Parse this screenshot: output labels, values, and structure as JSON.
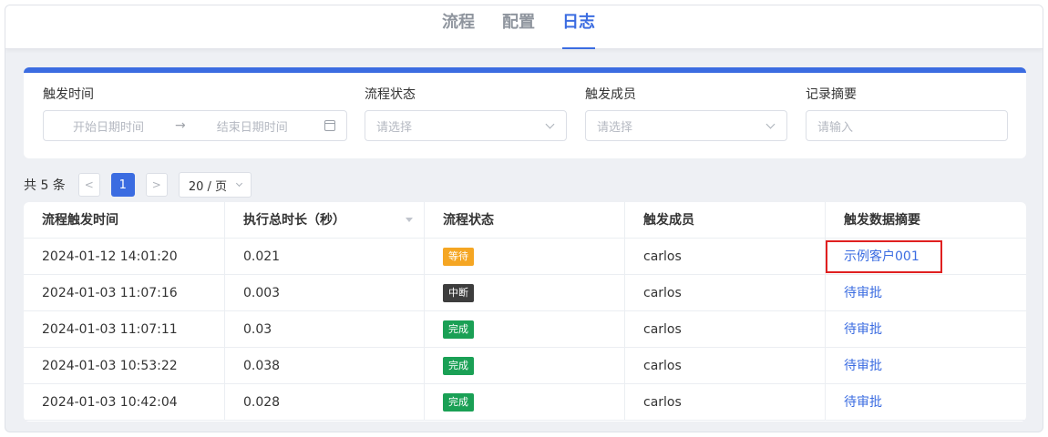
{
  "tabs": [
    {
      "label": "流程",
      "active": false
    },
    {
      "label": "配置",
      "active": false
    },
    {
      "label": "日志",
      "active": true
    }
  ],
  "filters": {
    "trigger_time": {
      "label": "触发时间",
      "start_placeholder": "开始日期时间",
      "arrow": "→",
      "end_placeholder": "结束日期时间"
    },
    "flow_status": {
      "label": "流程状态",
      "placeholder": "请选择"
    },
    "trigger_member": {
      "label": "触发成员",
      "placeholder": "请选择"
    },
    "record_summary": {
      "label": "记录摘要",
      "placeholder": "请输入"
    }
  },
  "pagination": {
    "total_text": "共 5 条",
    "prev": "<",
    "current_page": "1",
    "next": ">",
    "page_size": "20 / 页"
  },
  "table": {
    "columns": [
      "流程触发时间",
      "执行总时长（秒）",
      "流程状态",
      "触发成员",
      "触发数据摘要"
    ],
    "rows": [
      {
        "time": "2024-01-12 14:01:20",
        "duration": "0.021",
        "status": "等待",
        "status_color": "#f5a623",
        "member": "carlos",
        "summary": "示例客户001"
      },
      {
        "time": "2024-01-03 11:07:16",
        "duration": "0.003",
        "status": "中断",
        "status_color": "#3d3d3d",
        "member": "carlos",
        "summary": "待审批"
      },
      {
        "time": "2024-01-03 11:07:11",
        "duration": "0.03",
        "status": "完成",
        "status_color": "#1aa055",
        "member": "carlos",
        "summary": "待审批"
      },
      {
        "time": "2024-01-03 10:53:22",
        "duration": "0.038",
        "status": "完成",
        "status_color": "#1aa055",
        "member": "carlos",
        "summary": "待审批"
      },
      {
        "time": "2024-01-03 10:42:04",
        "duration": "0.028",
        "status": "完成",
        "status_color": "#1aa055",
        "member": "carlos",
        "summary": "待审批"
      }
    ]
  },
  "colors": {
    "accent": "#3b6ce1",
    "highlight": "#e02020"
  }
}
